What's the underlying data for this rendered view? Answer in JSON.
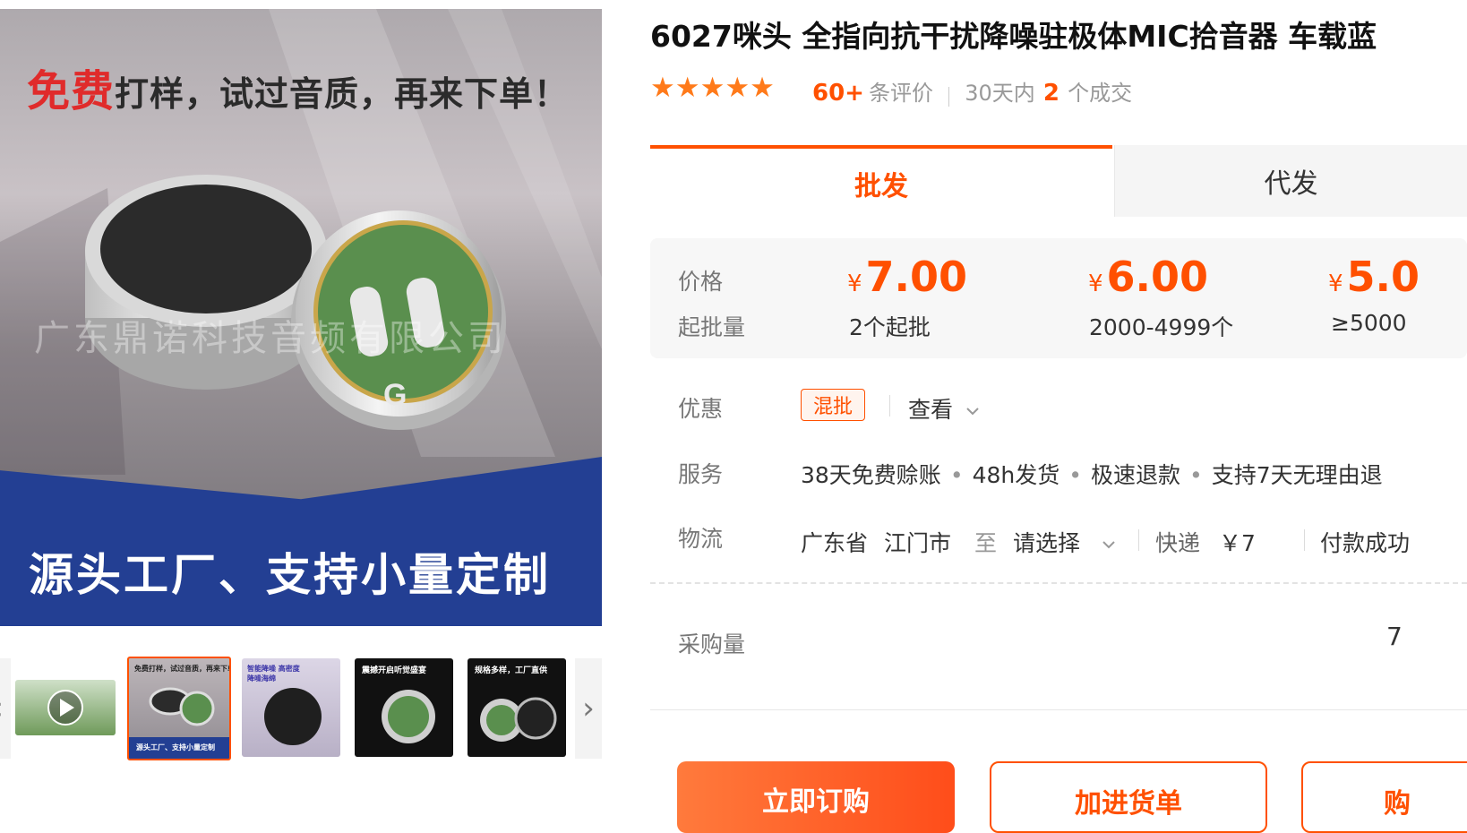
{
  "gallery": {
    "promo_red": "免费",
    "promo_rest": "打样，试过音质，再来下单！",
    "watermark": "广东鼎诺科技音频有限公司",
    "banner": "源头工厂、支持小量定制",
    "mic_plus": "+",
    "mic_g": "G",
    "prev_arrow": "‹",
    "next_arrow": "›",
    "thumbs": [
      {
        "kind": "video"
      },
      {
        "kind": "image",
        "top": "免费打样，试过音质，再来下单！",
        "bottom": "源头工厂、支持小量定制"
      },
      {
        "kind": "image",
        "top": "智能降噪 高密度降噪海绵"
      },
      {
        "kind": "image",
        "top": "震撼开启听觉盛宴"
      },
      {
        "kind": "image",
        "top": "规格多样，工厂直供"
      }
    ]
  },
  "product": {
    "title": "6027咪头 全指向抗干扰降噪驻极体MIC拾音器 车载蓝",
    "stars": "★★★★★",
    "rating_count": "60+",
    "rating_suffix": "条评价",
    "sales_prefix": "30天内",
    "sales_count": "2",
    "sales_suffix": "个成交"
  },
  "tabs": [
    {
      "label": "批发",
      "active": true
    },
    {
      "label": "代发",
      "active": false
    }
  ],
  "pricing": {
    "price_label": "价格",
    "moq_label": "起批量",
    "currency": "¥",
    "tiers": [
      {
        "price": "7.00",
        "qty": "2个起批"
      },
      {
        "price": "6.00",
        "qty": "2000-4999个"
      },
      {
        "price": "5.0",
        "qty": "≥5000"
      }
    ]
  },
  "promo": {
    "label": "优惠",
    "tag": "混批",
    "view": "查看"
  },
  "service": {
    "label": "服务",
    "items": [
      "38天免费赊账",
      "48h发货",
      "极速退款",
      "支持7天无理由退"
    ]
  },
  "logistics": {
    "label": "物流",
    "from_province": "广东省",
    "from_city": "江门市",
    "to": "至",
    "dest": "请选择",
    "method": "快递",
    "fee": "￥7",
    "pay_note": "付款成功"
  },
  "purchase": {
    "label": "采购量",
    "value": "7"
  },
  "buttons": {
    "buy": "立即订购",
    "cart": "加进货单",
    "third": "购"
  },
  "colors": {
    "accent": "#ff5000",
    "banner_blue": "#233f93",
    "mic_green": "#5a8f4e"
  }
}
